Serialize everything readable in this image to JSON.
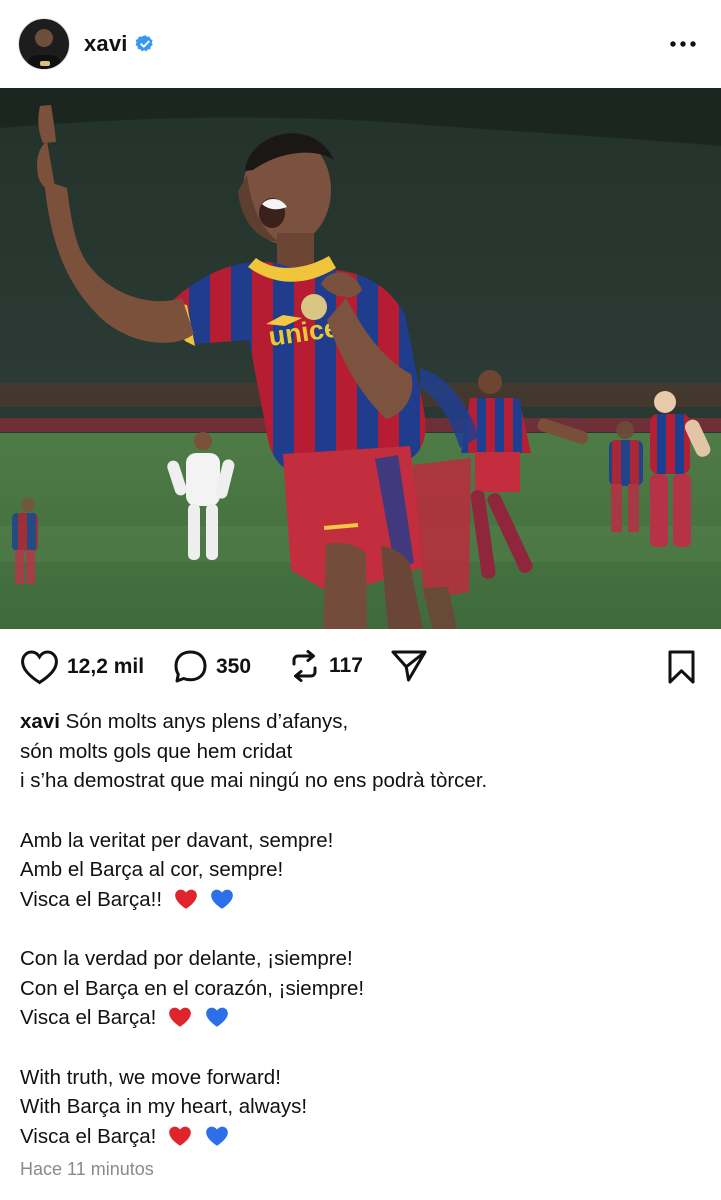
{
  "post": {
    "username": "xavi",
    "verified": true,
    "more_icon": "more-horizontal-icon",
    "likes": "12,2 mil",
    "comments": "350",
    "reposts": "117",
    "caption_lines": [
      "Són molts anys plens d’afanys,",
      "són molts gols que hem cridat",
      "i s’ha demostrat que mai ningú no ens podrà tòrcer."
    ],
    "paragraph_2": [
      "Amb la veritat per davant, sempre!",
      "Amb el Barça al cor, sempre!",
      "Visca el Barça!!"
    ],
    "paragraph_3": [
      "Con la verdad por delante, ¡siempre!",
      "Con el Barça en el corazón, ¡siempre!",
      "Visca el Barça!"
    ],
    "paragraph_4": [
      "With truth, we move forward!",
      "With Barça in my heart, always!",
      "Visca el Barça!"
    ],
    "timestamp": "Hace 11 minutos",
    "photo_jersey_text": "unicef"
  },
  "colors": {
    "verified_blue": "#3897f0",
    "heart_red": "#e0242e",
    "heart_blue": "#2d6fe8",
    "muted_text": "#8a8a8a"
  }
}
